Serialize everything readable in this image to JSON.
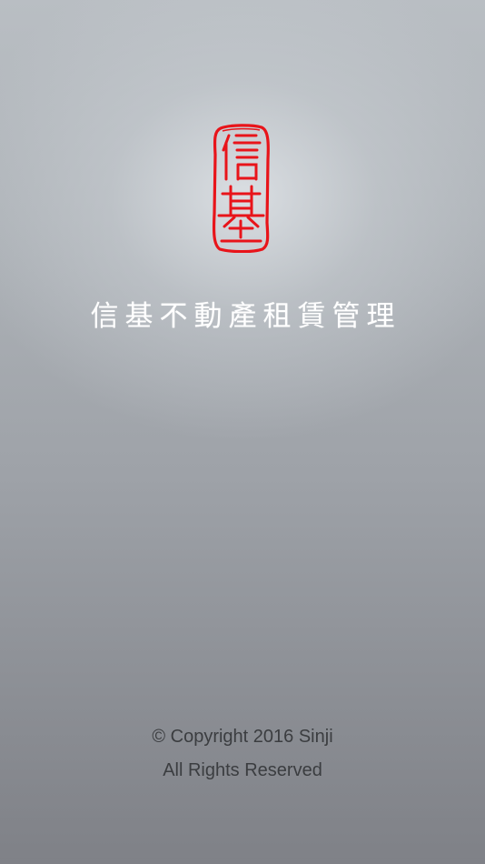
{
  "logo": {
    "name": "seal-logo",
    "seal_text": "信基",
    "color": "#e8141a"
  },
  "app_title": "信基不動產租賃管理",
  "footer": {
    "copyright": "© Copyright 2016 Sinji",
    "rights": "All Rights Reserved"
  },
  "colors": {
    "seal_red": "#e8141a",
    "title_text": "#ffffff",
    "footer_text": "#3b3d40"
  }
}
